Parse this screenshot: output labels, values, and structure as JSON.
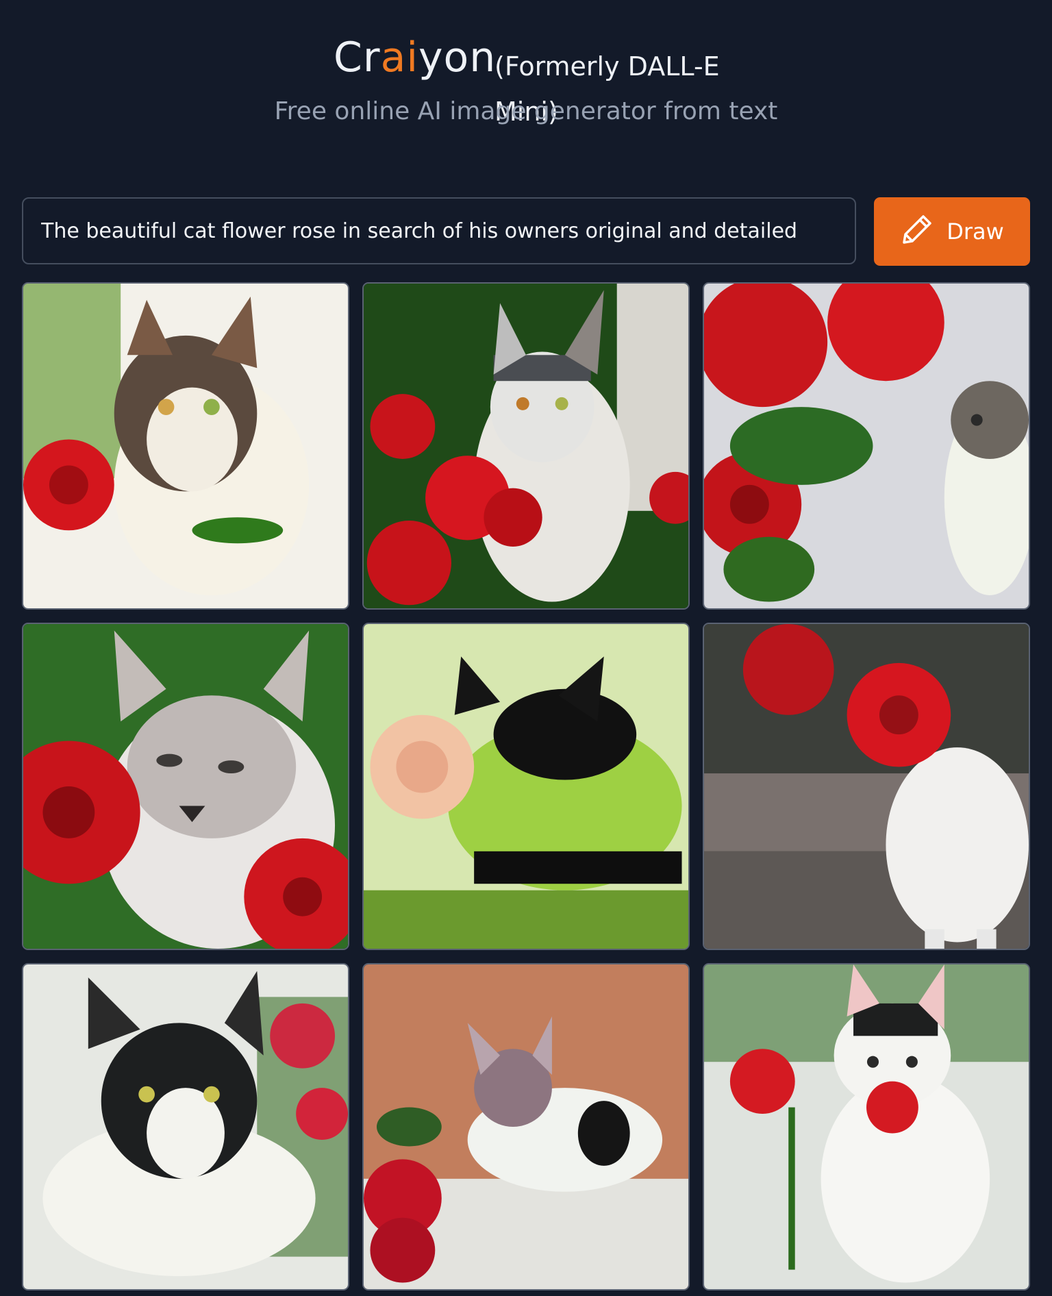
{
  "header": {
    "brand_prefix": "Cr",
    "brand_accent": "ai",
    "brand_suffix": "yon",
    "formerly": "(Formerly DALL-E Mini)",
    "tagline": "Free online AI image generator from text"
  },
  "prompt": {
    "value": "The beautiful cat flower rose in search of his owners original and detailed"
  },
  "draw_button": {
    "label": "Draw",
    "icon": "pencil-icon"
  },
  "colors": {
    "background": "#131a29",
    "accent": "#f07a22",
    "button": "#e8661a",
    "tagline": "#98a2b3"
  },
  "results": [
    {
      "subject": "cat-with-red-roses"
    },
    {
      "subject": "cat-with-red-roses"
    },
    {
      "subject": "cat-with-red-roses"
    },
    {
      "subject": "cat-with-red-roses"
    },
    {
      "subject": "cat-with-pink-flower"
    },
    {
      "subject": "cat-with-red-rose"
    },
    {
      "subject": "cat-with-red-roses"
    },
    {
      "subject": "kitten-with-roses"
    },
    {
      "subject": "cat-with-red-flowers"
    }
  ]
}
